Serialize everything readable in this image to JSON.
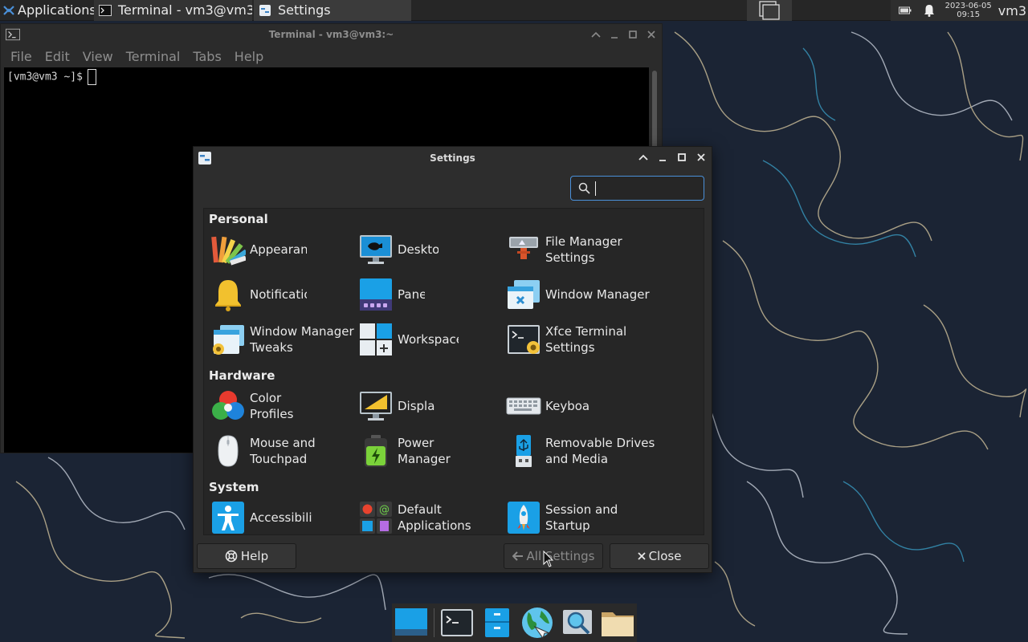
{
  "top_panel": {
    "applications_label": "Applications",
    "tasks": [
      {
        "label": "Terminal - vm3@vm3:~",
        "icon": "terminal-icon"
      },
      {
        "label": "Settings",
        "icon": "settings-icon"
      }
    ],
    "clock": {
      "date": "2023-06-05",
      "time": "09:15"
    },
    "user": "vm3"
  },
  "terminal": {
    "title": "Terminal - vm3@vm3:~",
    "menu": [
      "File",
      "Edit",
      "View",
      "Terminal",
      "Tabs",
      "Help"
    ],
    "prompt": "[vm3@vm3 ~]$"
  },
  "settings": {
    "title": "Settings",
    "search": {
      "value": "",
      "placeholder": ""
    },
    "sections": [
      {
        "title": "Personal",
        "items": [
          {
            "label": "Appearance",
            "icon": "appearance-icon"
          },
          {
            "label": "Desktop",
            "icon": "desktop-icon"
          },
          {
            "label": "File Manager Settings",
            "icon": "file-manager-icon"
          },
          {
            "label": "Notifications",
            "icon": "notifications-bell-icon"
          },
          {
            "label": "Panel",
            "icon": "panel-icon"
          },
          {
            "label": "Window Manager",
            "icon": "window-manager-icon"
          },
          {
            "label": "Window Manager Tweaks",
            "icon": "wm-tweaks-icon"
          },
          {
            "label": "Workspaces",
            "icon": "workspaces-icon"
          },
          {
            "label": "Xfce Terminal Settings",
            "icon": "terminal-settings-icon"
          }
        ]
      },
      {
        "title": "Hardware",
        "items": [
          {
            "label": "Color Profiles",
            "icon": "color-profiles-icon"
          },
          {
            "label": "Display",
            "icon": "display-icon"
          },
          {
            "label": "Keyboard",
            "icon": "keyboard-icon"
          },
          {
            "label": "Mouse and Touchpad",
            "icon": "mouse-icon"
          },
          {
            "label": "Power Manager",
            "icon": "power-manager-icon"
          },
          {
            "label": "Removable Drives and Media",
            "icon": "removable-drives-icon"
          }
        ]
      },
      {
        "title": "System",
        "items": [
          {
            "label": "Accessibility",
            "icon": "accessibility-icon"
          },
          {
            "label": "Default Applications",
            "icon": "default-applications-icon"
          },
          {
            "label": "Session and Startup",
            "icon": "session-startup-icon"
          }
        ]
      }
    ],
    "buttons": {
      "help": "Help",
      "all_settings": "All Settings",
      "close": "Close"
    }
  },
  "dock": [
    "show-desktop-icon",
    "terminal-icon",
    "file-manager-icon",
    "web-browser-icon",
    "app-finder-icon",
    "home-folder-icon"
  ],
  "colors": {
    "accent": "#4a90d9",
    "panel": "#262626",
    "window": "#2d2d2d"
  }
}
